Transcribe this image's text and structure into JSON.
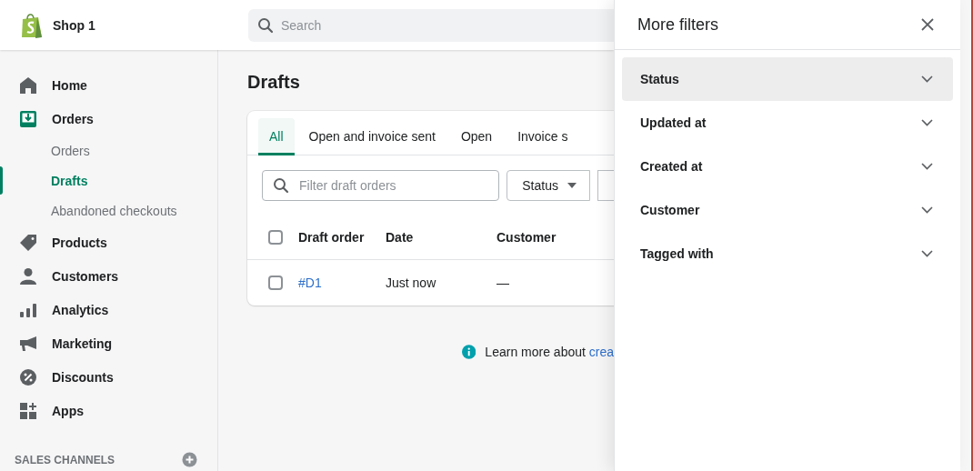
{
  "topbar": {
    "shop_name": "Shop 1",
    "search": {
      "placeholder": "Search"
    }
  },
  "sidebar": {
    "items": [
      {
        "label": "Home",
        "selected": false
      },
      {
        "label": "Orders",
        "selected": true,
        "children": [
          {
            "label": "Orders",
            "selected": false
          },
          {
            "label": "Drafts",
            "selected": true
          },
          {
            "label": "Abandoned checkouts",
            "selected": false
          }
        ]
      },
      {
        "label": "Products",
        "selected": false
      },
      {
        "label": "Customers",
        "selected": false
      },
      {
        "label": "Analytics",
        "selected": false
      },
      {
        "label": "Marketing",
        "selected": false
      },
      {
        "label": "Discounts",
        "selected": false
      },
      {
        "label": "Apps",
        "selected": false
      }
    ],
    "section": "SALES CHANNELS"
  },
  "page": {
    "title": "Drafts",
    "tabs": [
      {
        "label": "All",
        "selected": true
      },
      {
        "label": "Open and invoice sent",
        "selected": false
      },
      {
        "label": "Open",
        "selected": false
      },
      {
        "label": "Invoice s",
        "selected": false
      }
    ],
    "filter": {
      "placeholder": "Filter draft orders"
    },
    "status_button": "Status",
    "table": {
      "select_all_checked": false,
      "columns": [
        "Draft order",
        "Date",
        "Customer"
      ],
      "rows": [
        {
          "checked": false,
          "cells": [
            "#D1",
            "Just now",
            "—"
          ]
        }
      ]
    },
    "learn_more": {
      "text": "Learn more about ",
      "link": "crea"
    }
  },
  "panel": {
    "title": "More filters",
    "sections": [
      {
        "label": "Status",
        "selected": true
      },
      {
        "label": "Updated at",
        "selected": false
      },
      {
        "label": "Created at",
        "selected": false
      },
      {
        "label": "Customer",
        "selected": false
      },
      {
        "label": "Tagged with",
        "selected": false
      }
    ]
  }
}
